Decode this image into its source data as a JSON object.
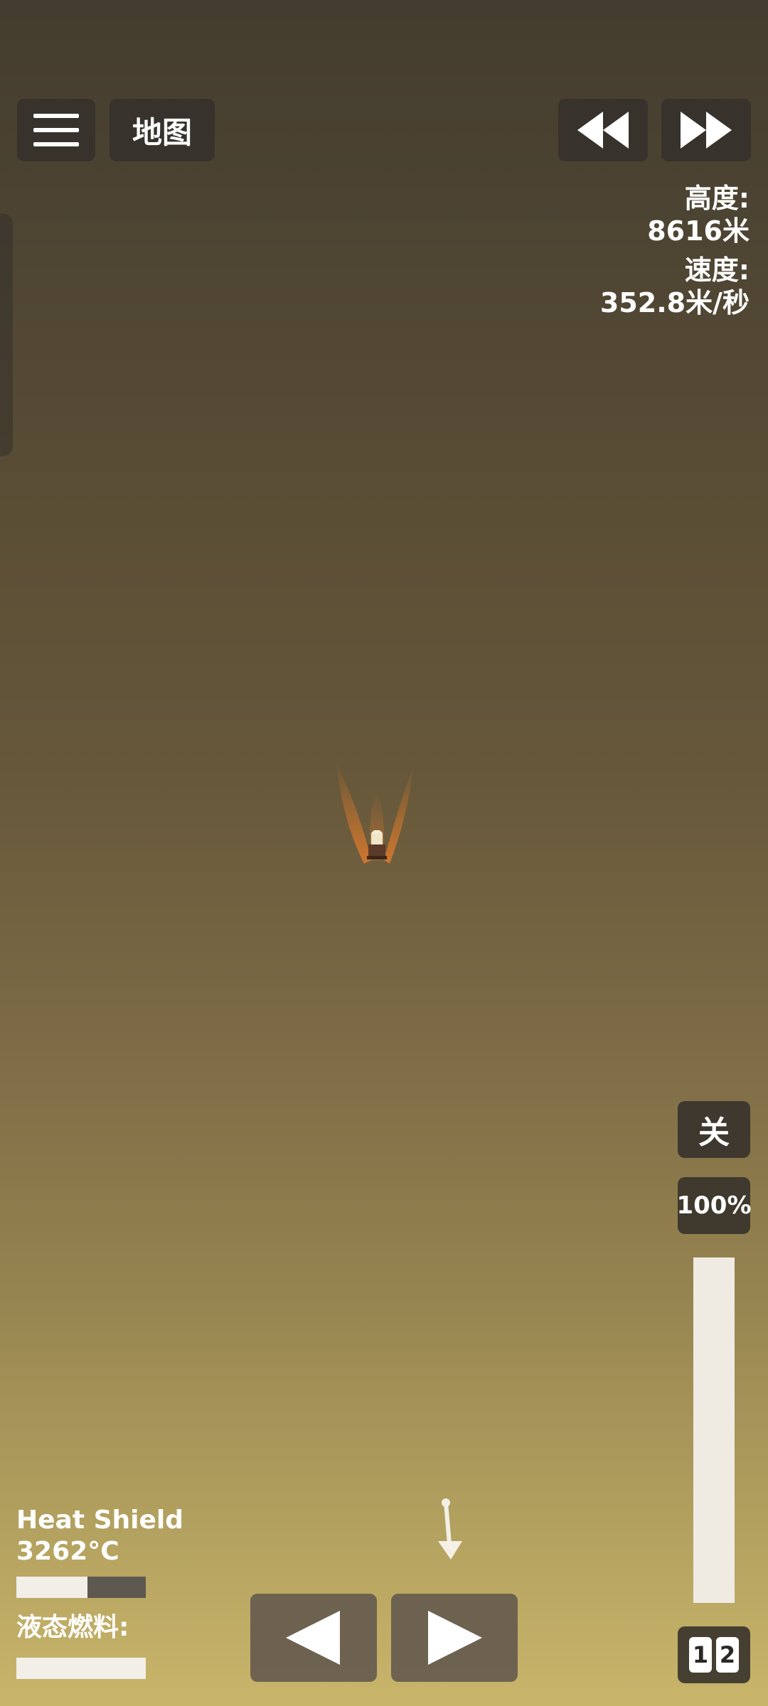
{
  "toolbar": {
    "map_label": "地图"
  },
  "telemetry": {
    "altitude_label": "高度:",
    "altitude_value": "8616米",
    "speed_label": "速度:",
    "speed_value": "352.8米/秒"
  },
  "throttle": {
    "off_label": "关",
    "percent_label": "100%",
    "level": 1.0
  },
  "stages": {
    "digits": [
      "1",
      "2"
    ]
  },
  "heat_shield": {
    "name": "Heat Shield",
    "temperature": "3262°C",
    "level": 0.55
  },
  "fuel": {
    "label": "液态燃料:",
    "level": 1.0
  },
  "colors": {
    "button_bg": "#34302a",
    "bar_fill": "#efebe3",
    "flame": "#e07a2a"
  },
  "icons": {
    "menu": "hamburger-icon",
    "rewind": "rewind-icon",
    "fast_forward": "fast-forward-icon",
    "rotate_left": "triangle-left-icon",
    "rotate_right": "triangle-right-icon"
  }
}
